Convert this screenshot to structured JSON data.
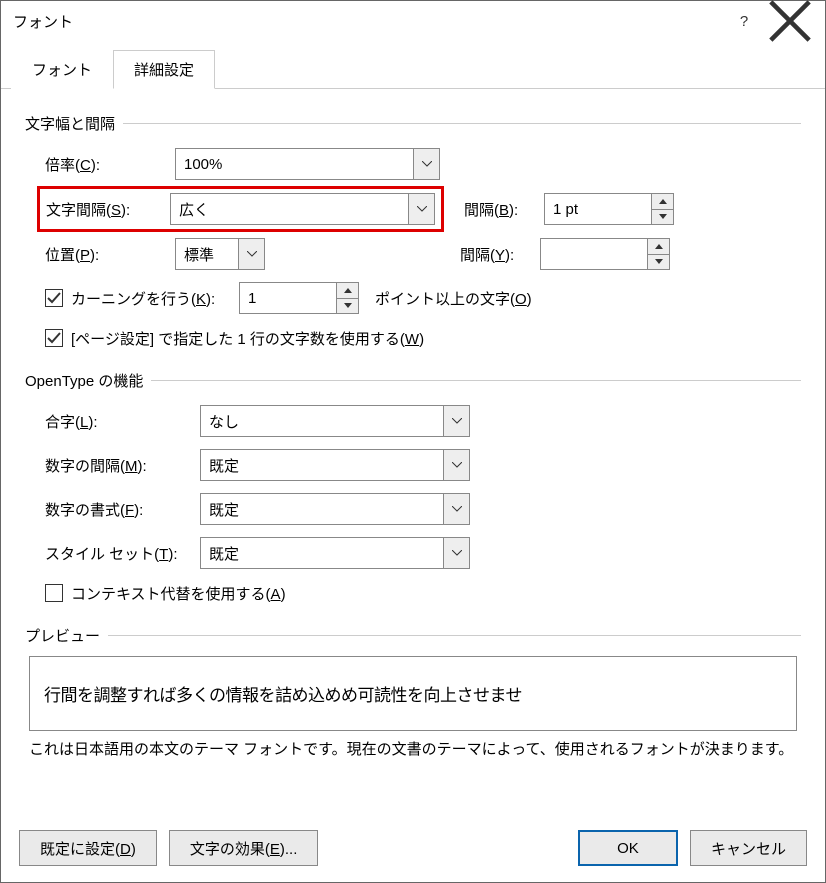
{
  "title": "フォント",
  "tabs": {
    "font": "フォント",
    "advanced": "詳細設定"
  },
  "charSpacing": {
    "legend": "文字幅と間隔",
    "scaleLabel": "倍率(C):",
    "scaleValue": "100%",
    "spacingLabel": "文字間隔(S):",
    "spacingValue": "広く",
    "spacingByLabel": "間隔(B):",
    "spacingByValue": "1 pt",
    "positionLabel": "位置(P):",
    "positionValue": "標準",
    "posByLabel": "間隔(Y):",
    "posByValue": "",
    "kerningLabel": "カーニングを行う(K):",
    "kerningValue": "1",
    "kerningAfter": "ポイント以上の文字(O)",
    "pageGrid": "[ページ設定] で指定した 1 行の文字数を使用する(W)"
  },
  "opentype": {
    "legend": "OpenType の機能",
    "ligatureLabel": "合字(L):",
    "ligatureValue": "なし",
    "numSpacingLabel": "数字の間隔(M):",
    "numSpacingValue": "既定",
    "numFormLabel": "数字の書式(F):",
    "numFormValue": "既定",
    "styleSetLabel": "スタイル セット(T):",
    "styleSetValue": "既定",
    "contextAlt": "コンテキスト代替を使用する(A)"
  },
  "preview": {
    "legend": "プレビュー",
    "sample": "行間を調整すれば多くの情報を詰め込めめ可読性を向上させませ",
    "desc": "これは日本語用の本文のテーマ フォントです。現在の文書のテーマによって、使用されるフォントが決まります。"
  },
  "footer": {
    "setDefault": "既定に設定(D)",
    "textEffects": "文字の効果(E)...",
    "ok": "OK",
    "cancel": "キャンセル"
  }
}
